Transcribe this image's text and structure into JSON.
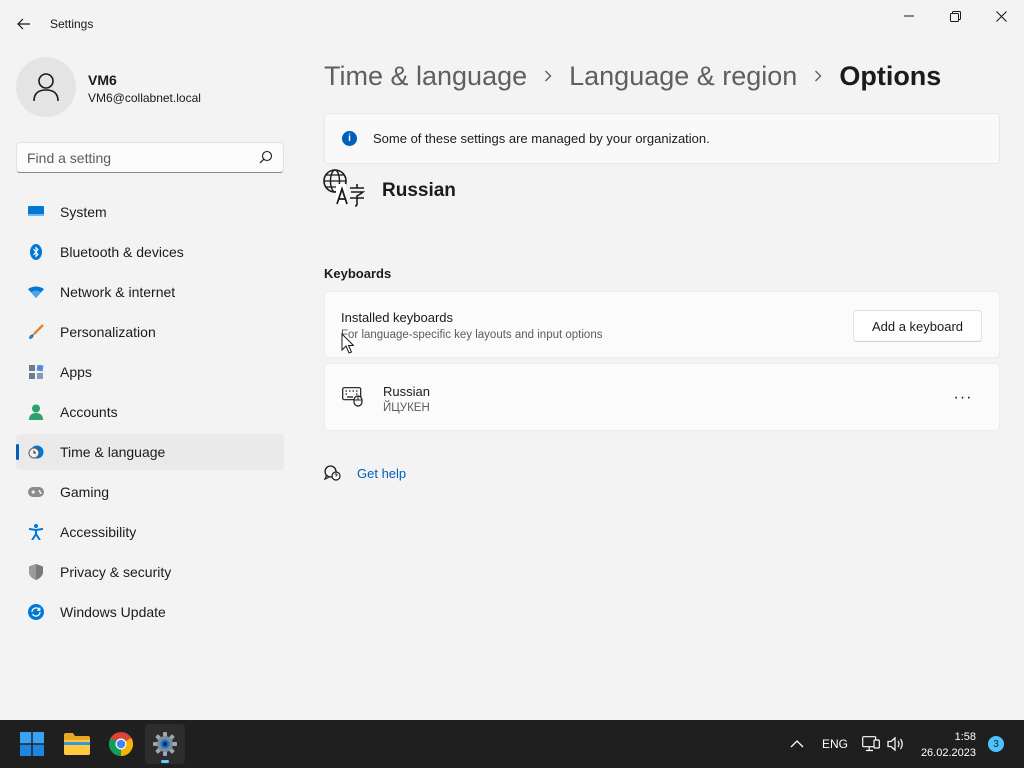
{
  "window": {
    "title": "Settings"
  },
  "user": {
    "name": "VM6",
    "email": "VM6@collabnet.local"
  },
  "search": {
    "placeholder": "Find a setting"
  },
  "sidebar": {
    "items": [
      {
        "label": "System",
        "icon": "system-icon"
      },
      {
        "label": "Bluetooth & devices",
        "icon": "bluetooth-icon"
      },
      {
        "label": "Network & internet",
        "icon": "network-icon"
      },
      {
        "label": "Personalization",
        "icon": "personalization-icon"
      },
      {
        "label": "Apps",
        "icon": "apps-icon"
      },
      {
        "label": "Accounts",
        "icon": "accounts-icon"
      },
      {
        "label": "Time & language",
        "icon": "time-language-icon",
        "active": true
      },
      {
        "label": "Gaming",
        "icon": "gaming-icon"
      },
      {
        "label": "Accessibility",
        "icon": "accessibility-icon"
      },
      {
        "label": "Privacy & security",
        "icon": "privacy-icon"
      },
      {
        "label": "Windows Update",
        "icon": "windows-update-icon"
      }
    ]
  },
  "breadcrumb": {
    "items": [
      "Time & language",
      "Language & region"
    ],
    "current": "Options"
  },
  "info": {
    "text": "Some of these settings are managed by your organization."
  },
  "language": {
    "name": "Russian"
  },
  "keyboards": {
    "section_title": "Keyboards",
    "installed_title": "Installed keyboards",
    "installed_subtitle": "For language-specific key layouts and input options",
    "add_button": "Add a keyboard",
    "items": [
      {
        "name": "Russian",
        "layout": "ЙЦУКЕН"
      }
    ],
    "more_label": "···"
  },
  "help": {
    "label": "Get help"
  },
  "taskbar": {
    "language": "ENG",
    "time": "1:58",
    "date": "26.02.2023",
    "notification_count": "3"
  },
  "colors": {
    "accent": "#005fb8",
    "taskbar": "#1f1f1f"
  }
}
